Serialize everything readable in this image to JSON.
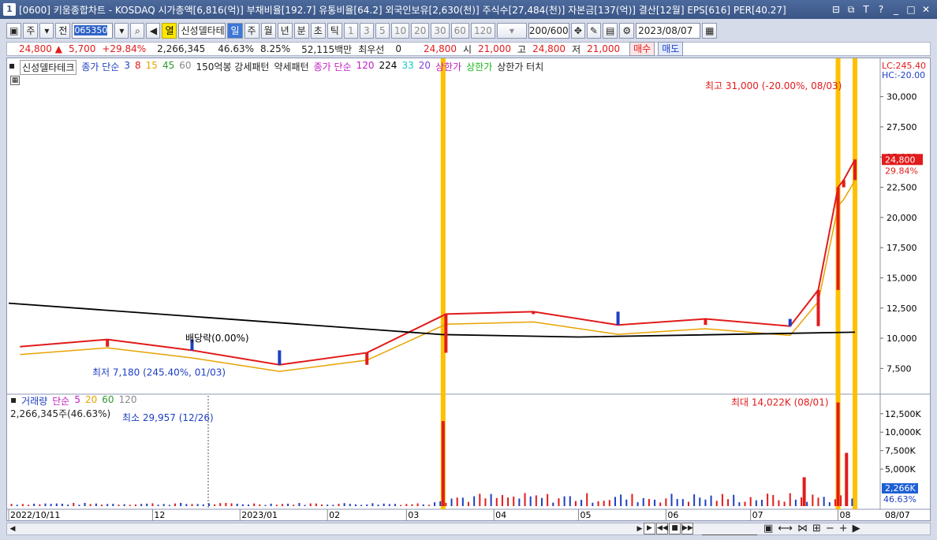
{
  "window": {
    "number": "1",
    "title": "[0600] 키움종합차트 - KOSDAQ 시가총액[6,816(억)] 부채비율[192.7] 유통비율[64.2] 외국인보유[2,630(천)] 주식수[27,484(천)] 자본금[137(억)] 결산[12월] EPS[616] PER[40.27]"
  },
  "toolbar": {
    "period_main": "주",
    "jeon": "전",
    "code": "065350",
    "open_label": "열",
    "stock_name": "신성델타테",
    "periods": [
      "일",
      "주",
      "월",
      "년",
      "분",
      "초",
      "틱"
    ],
    "intervals": [
      "1",
      "3",
      "5",
      "10",
      "20",
      "30",
      "60",
      "120"
    ],
    "count": "200/600",
    "date": "2023/08/07"
  },
  "quote": {
    "price": "24,800",
    "change": "5,700",
    "change_pct": "+29.84%",
    "volume": "2,266,345",
    "vol_ratio": "46.63%",
    "turnover": "8.25%",
    "amount": "52,115백만",
    "priority_label": "최우선",
    "priority_val": "0",
    "bid": "24,800",
    "open_label": "시",
    "open": "21,000",
    "high_label": "고",
    "high": "24,800",
    "low_label": "저",
    "low": "21,000",
    "buy": "매수",
    "sell": "매도"
  },
  "legend": {
    "name": "신성델타테크",
    "ma_label": "종가 단순",
    "ma_periods": [
      "3",
      "8",
      "15",
      "45",
      "60"
    ],
    "bars150": "150억봉 강세패턴",
    "weak": "약세패턴",
    "ma2_label": "종가 단순",
    "ma2_periods": [
      "120",
      "224",
      "33",
      "20"
    ],
    "upper_limit": "상한가",
    "upper_limit2": "상한가",
    "upper_touch": "상한가 터치"
  },
  "vol_legend": {
    "label": "거래량",
    "ma_label": "단순",
    "periods": [
      "5",
      "20",
      "60",
      "120"
    ],
    "current": "2,266,345주(46.63%)"
  },
  "price_axis": {
    "lc": "LC:245.40",
    "hc": "HC:-20.00",
    "ticks": [
      "30,000",
      "27,500",
      "25,000",
      "22,500",
      "20,000",
      "17,500",
      "15,000",
      "12,500",
      "10,000",
      "7,500"
    ],
    "current_price": "24,800",
    "current_pct": "29.84%"
  },
  "vol_axis": {
    "ticks": [
      "12,500K",
      "10,000K",
      "7,500K",
      "5,000K"
    ],
    "current": "2,266K",
    "current_pct": "46.63%"
  },
  "annotations": {
    "high": "최고 31,000 (-20.00%, 08/03)",
    "low": "최저 7,180 (245.40%, 01/03)",
    "dividend": "배당락(0.00%)",
    "vol_max": "최대 14,022K (08/01)",
    "vol_min": "최소 29,957 (12/26)"
  },
  "x_axis": {
    "labels": [
      "2022/10/11",
      "12",
      "2023/01",
      "02",
      "03",
      "04",
      "05",
      "06",
      "07",
      "08"
    ],
    "end_label": "08/07"
  },
  "chart_data": {
    "type": "candlestick",
    "price_range": [
      5500,
      32000
    ],
    "volume_range_k": [
      0,
      14500
    ],
    "close_series": [
      {
        "date": "2022-10",
        "value": 9300
      },
      {
        "date": "2022-11",
        "value": 9900
      },
      {
        "date": "2022-12",
        "value": 9000
      },
      {
        "date": "2023-01",
        "value": 7800
      },
      {
        "date": "2023-02",
        "value": 8800
      },
      {
        "date": "2023-03",
        "value": 12000
      },
      {
        "date": "2023-04",
        "value": 12200
      },
      {
        "date": "2023-05",
        "value": 11100
      },
      {
        "date": "2023-06",
        "value": 11600
      },
      {
        "date": "2023-07",
        "value": 11000
      },
      {
        "date": "2023-07-25",
        "value": 14000
      },
      {
        "date": "2023-08-01",
        "value": 22500
      },
      {
        "date": "2023-08-03",
        "value": 23100
      },
      {
        "date": "2023-08-07",
        "value": 24800
      }
    ],
    "volume_spikes_k": [
      {
        "date": "2023-03-14",
        "value": 11500
      },
      {
        "date": "2023-07-20",
        "value": 3900
      },
      {
        "date": "2023-08-01",
        "value": 14022
      },
      {
        "date": "2023-08-04",
        "value": 7200
      }
    ],
    "colors": {
      "up": "#e21b1b",
      "down": "#1e3fc2",
      "highlight": "#ffc000"
    }
  }
}
